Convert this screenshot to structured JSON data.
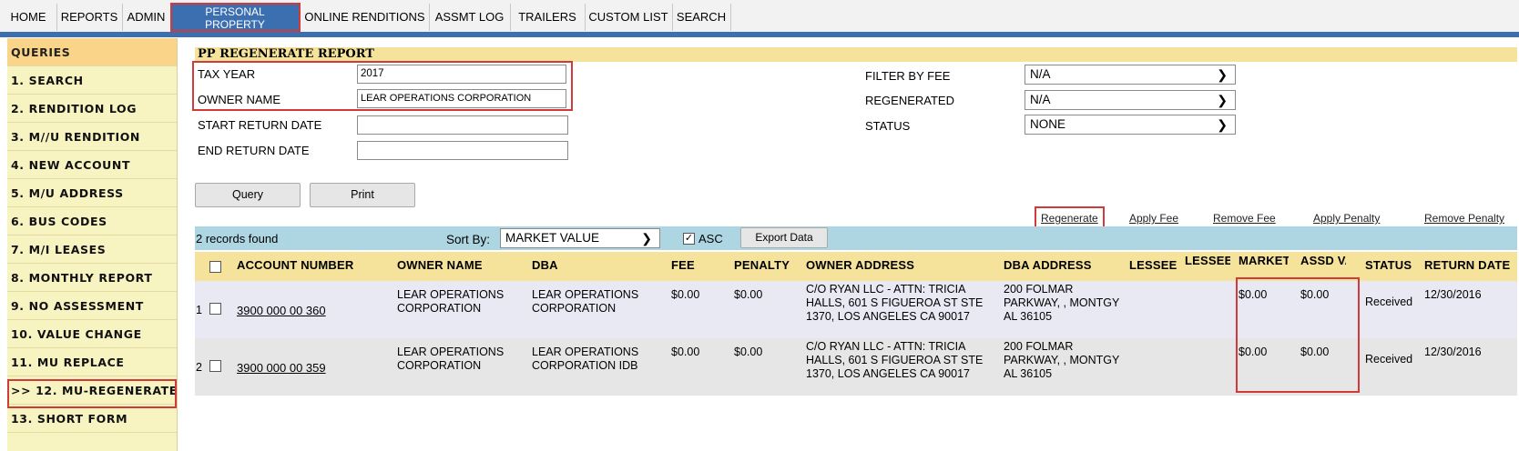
{
  "nav": {
    "tabs": [
      "HOME",
      "REPORTS",
      "ADMIN",
      "PERSONAL\nPROPERTY",
      "ONLINE RENDITIONS",
      "ASSMT LOG",
      "TRAILERS",
      "CUSTOM LIST",
      "SEARCH"
    ],
    "active": "PERSONAL PROPERTY"
  },
  "sidebar": {
    "header": "QUERIES",
    "items": [
      "1. SEARCH",
      "2. RENDITION LOG",
      "3. M//U RENDITION",
      "4. NEW ACCOUNT",
      "5. M/U ADDRESS",
      "6. BUS CODES",
      "7. M/I LEASES",
      "8. MONTHLY REPORT",
      "9. NO ASSESSMENT",
      "10. VALUE CHANGE",
      "11. MU REPLACE",
      ">> 12. MU-REGENERATE",
      "13. SHORT FORM"
    ]
  },
  "report": {
    "title": "PP REGENERATE REPORT",
    "tax_year_label": "TAX YEAR",
    "tax_year": "2017",
    "owner_name_label": "OWNER NAME",
    "owner_name": "LEAR OPERATIONS CORPORATION",
    "start_return_label": "START RETURN DATE",
    "start_return": "",
    "end_return_label": "END RETURN DATE",
    "end_return": "",
    "filter_fee_label": "FILTER BY FEE",
    "filter_fee": "N/A",
    "regenerated_label": "REGENERATED",
    "regenerated": "N/A",
    "status_label": "STATUS",
    "status": "NONE",
    "query_btn": "Query",
    "print_btn": "Print"
  },
  "actions": {
    "regenerate": "Regenerate",
    "apply_fee": "Apply Fee",
    "remove_fee": "Remove Fee",
    "apply_penalty": "Apply Penalty",
    "remove_penalty": "Remove Penalty"
  },
  "controls": {
    "records_found": "2 records found",
    "sort_by_label": "Sort By:",
    "sort_by": "MARKET VALUE",
    "asc_label": "ASC",
    "asc_checked": true,
    "export": "Export Data"
  },
  "table": {
    "headers": {
      "account": "ACCOUNT NUMBER",
      "owner": "OWNER NAME",
      "dba": "DBA",
      "fee": "FEE",
      "penalty": "PENALTY",
      "owner_addr": "OWNER ADDRESS",
      "dba_addr": "DBA ADDRESS",
      "lessee": "LESSEE",
      "lessee_addr": "LESSEE ADDR",
      "market": "MARKET VALUE",
      "assd": "ASSD VALUE",
      "status": "STATUS",
      "return_date": "RETURN DATE"
    },
    "rows": [
      {
        "num": "1",
        "account": "3900 000 00 360",
        "owner": "LEAR OPERATIONS\nCORPORATION",
        "dba": "LEAR OPERATIONS\nCORPORATION",
        "fee": "$0.00",
        "penalty": "$0.00",
        "owner_addr": "C/O RYAN LLC - ATTN: TRICIA\nHALLS, 601 S FIGUEROA ST STE\n1370, LOS ANGELES CA 90017",
        "dba_addr": "200 FOLMAR\nPARKWAY, , MONTGY\nAL 36105",
        "lessee": "",
        "lessee_addr": "",
        "market": "$0.00",
        "assd": "$0.00",
        "status": "Received",
        "return_date": "12/30/2016"
      },
      {
        "num": "2",
        "account": "3900 000 00 359",
        "owner": "LEAR OPERATIONS\nCORPORATION",
        "dba": "LEAR OPERATIONS\nCORPORATION IDB",
        "fee": "$0.00",
        "penalty": "$0.00",
        "owner_addr": "C/O RYAN LLC - ATTN: TRICIA\nHALLS, 601 S FIGUEROA ST STE\n1370, LOS ANGELES CA 90017",
        "dba_addr": "200 FOLMAR\nPARKWAY, , MONTGY\nAL 36105",
        "lessee": "",
        "lessee_addr": "",
        "market": "$0.00",
        "assd": "$0.00",
        "status": "Received",
        "return_date": "12/30/2016"
      }
    ]
  },
  "colors": {
    "nav_active": "#3b6fb0",
    "sidebar_bg": "#f8f4c2",
    "header_bg": "#f5e39b",
    "control_bar": "#aed6e2",
    "highlight": "#d23a3a"
  }
}
